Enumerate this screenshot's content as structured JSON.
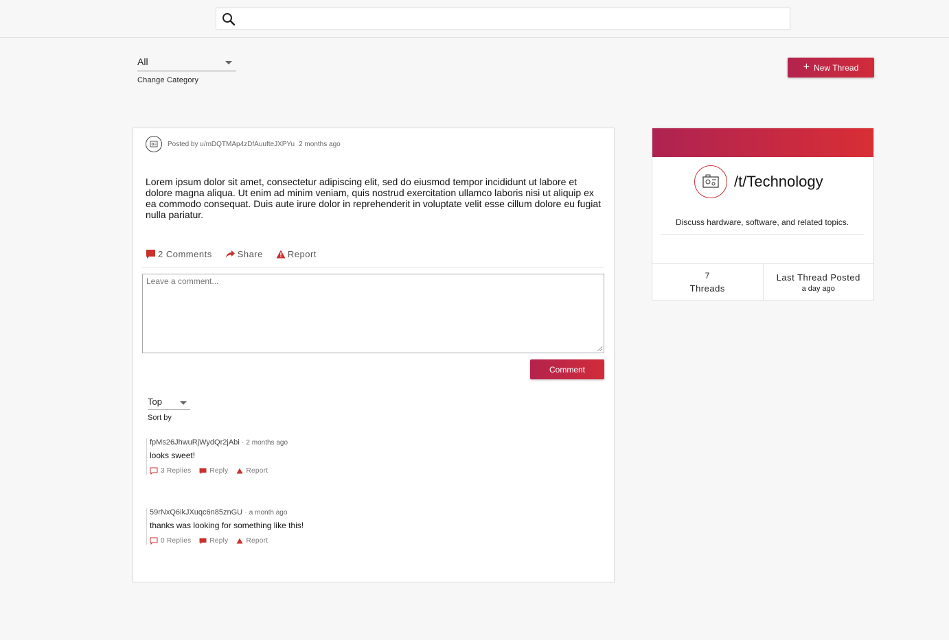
{
  "search": {
    "placeholder": "",
    "value": ""
  },
  "category": {
    "selected": "All",
    "helper": "Change Category"
  },
  "toolbar": {
    "new_thread_label": "New Thread"
  },
  "post": {
    "posted_by": "Posted by u/mDQTMAp4zDfAuufteJXPYu",
    "time": "2 months ago",
    "body": "Lorem ipsum dolor sit amet, consectetur adipiscing elit, sed do eiusmod tempor incididunt ut labore et dolore magna aliqua. Ut enim ad minim veniam, quis nostrud exercitation ullamco laboris nisi ut aliquip ex ea commodo consequat. Duis aute irure dolor in reprehenderit in voluptate velit esse cillum dolore eu fugiat nulla pariatur.",
    "actions": {
      "comments": "2 Comments",
      "share": "Share",
      "report": "Report"
    }
  },
  "comment_form": {
    "placeholder": "Leave a comment...",
    "submit_label": "Comment"
  },
  "sort": {
    "selected": "Top",
    "helper": "Sort by"
  },
  "comments": [
    {
      "author": "fpMs26JhwuRjWydQr2jAbi",
      "time": "2 months ago",
      "text": "looks sweet!",
      "replies": "3 Replies",
      "reply": "Reply",
      "report": "Report"
    },
    {
      "author": "59rNxQ6ikJXuqc6n85znGU",
      "time": "a month ago",
      "text": "thanks was looking for something like this!",
      "replies": "0 Replies",
      "reply": "Reply",
      "report": "Report"
    }
  ],
  "sidebar": {
    "category_name": "/t/Technology",
    "description": "Discuss hardware, software, and related topics.",
    "threads_count": "7",
    "threads_label": "Threads",
    "last_posted_label": "Last Thread Posted",
    "last_posted_time": "a day ago"
  },
  "colors": {
    "accent_start": "#b3234d",
    "accent_end": "#d12c3a",
    "icon_red": "#c9302c"
  },
  "icons": [
    "search-icon",
    "plus-icon",
    "avatar-icon",
    "comment-icon",
    "share-icon",
    "report-icon",
    "technology-icon"
  ]
}
